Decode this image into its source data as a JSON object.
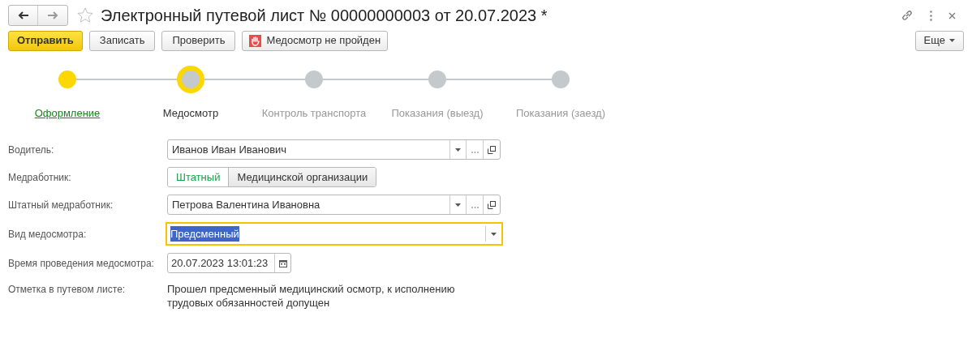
{
  "window": {
    "title": "Электронный путевой лист № 00000000003 от 20.07.2023 *",
    "favorite": false
  },
  "toolbar": {
    "buttons": [
      {
        "label": "Отправить",
        "kind": "primary"
      },
      {
        "label": "Записать",
        "kind": "plain"
      },
      {
        "label": "Проверить",
        "kind": "plain"
      },
      {
        "label": "Медосмотр не пройден",
        "kind": "stop"
      }
    ],
    "more": "Еще"
  },
  "steps": [
    {
      "label": "Оформление",
      "completed": true,
      "selected": false
    },
    {
      "label": "Медосмотр",
      "completed": false,
      "selected": true
    },
    {
      "label": "Контроль транспорта",
      "completed": false,
      "selected": false
    },
    {
      "label": "Показания (выезд)",
      "completed": false,
      "selected": false
    },
    {
      "label": "Показания (заезд)",
      "completed": false,
      "selected": false
    }
  ],
  "fields": [
    {
      "label": "Водитель:",
      "kind": "reference",
      "value": "Иванов Иван Иванович",
      "focused": false
    },
    {
      "label": "Медработник:",
      "kind": "toggle",
      "options": [
        {
          "label": "Штатный",
          "selected": true
        },
        {
          "label": "Медицинской организации",
          "selected": false
        }
      ]
    },
    {
      "label": "Штатный медработник:",
      "kind": "reference",
      "value": "Петрова Валентина Ивановна",
      "focused": false
    },
    {
      "label": "Вид медосмотра:",
      "kind": "choice",
      "value": "Предсменный",
      "focused": true
    },
    {
      "label": "Время проведения медосмотра:",
      "kind": "datetime",
      "value": "20.07.2023 13:01:23"
    },
    {
      "label": "Отметка в путевом листе:",
      "kind": "note",
      "value": "Прошел предсменный медицинский осмотр, к исполнению трудовых обязанностей допущен"
    }
  ]
}
